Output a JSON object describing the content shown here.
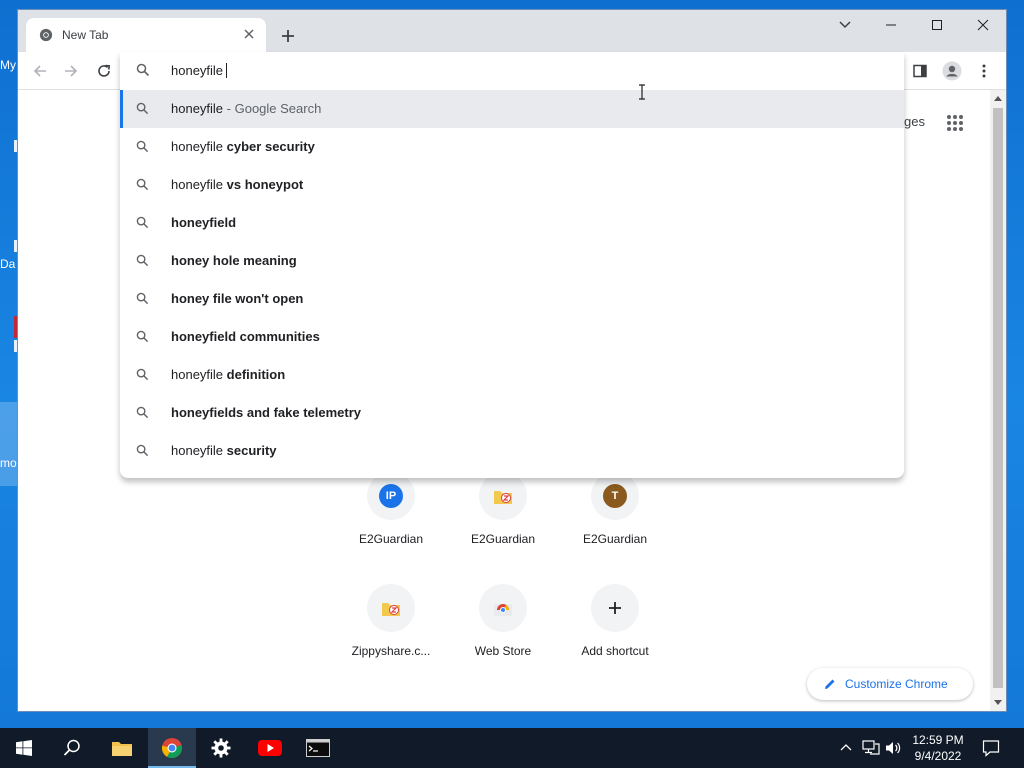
{
  "desktop": {
    "fragments": [
      "My",
      "Da",
      "mo"
    ]
  },
  "browser": {
    "tab_title": "New Tab",
    "omnibox": {
      "input_value": "honeyfile",
      "suggestions": [
        {
          "prefix": "honeyfile",
          "bold": "",
          "suffix": " - Google Search"
        },
        {
          "prefix": "honeyfile ",
          "bold": "cyber security",
          "suffix": ""
        },
        {
          "prefix": "honeyfile ",
          "bold": "vs honeypot",
          "suffix": ""
        },
        {
          "prefix": "",
          "bold": "honeyfield",
          "suffix": ""
        },
        {
          "prefix": "",
          "bold": "honey hole meaning",
          "suffix": ""
        },
        {
          "prefix": "",
          "bold": "honey file won't open",
          "suffix": ""
        },
        {
          "prefix": "",
          "bold": "honeyfield communities",
          "suffix": ""
        },
        {
          "prefix": "honeyfile ",
          "bold": "definition",
          "suffix": ""
        },
        {
          "prefix": "",
          "bold": "honeyfields and fake telemetry",
          "suffix": ""
        },
        {
          "prefix": "honeyfile ",
          "bold": "security",
          "suffix": ""
        }
      ]
    },
    "ntp": {
      "images_link_partial": "ges",
      "shortcuts": [
        {
          "label": "E2Guardian",
          "icon_text": "IP",
          "icon_color": "#1a73e8"
        },
        {
          "label": "E2Guardian",
          "icon_text": "",
          "icon_color": ""
        },
        {
          "label": "E2Guardian",
          "icon_text": "T",
          "icon_color": "#8a5a1e"
        },
        {
          "label": "Zippyshare.c...",
          "icon_text": "",
          "icon_color": ""
        },
        {
          "label": "Web Store",
          "icon_text": "",
          "icon_color": ""
        },
        {
          "label": "Add shortcut",
          "icon_text": "",
          "icon_color": ""
        }
      ],
      "customize_label": "Customize Chrome"
    }
  },
  "taskbar": {
    "time": "12:59 PM",
    "date": "9/4/2022"
  },
  "colors": {
    "accent": "#1a73e8",
    "titlebar": "#dee1e6",
    "taskbar": "#101a28"
  }
}
